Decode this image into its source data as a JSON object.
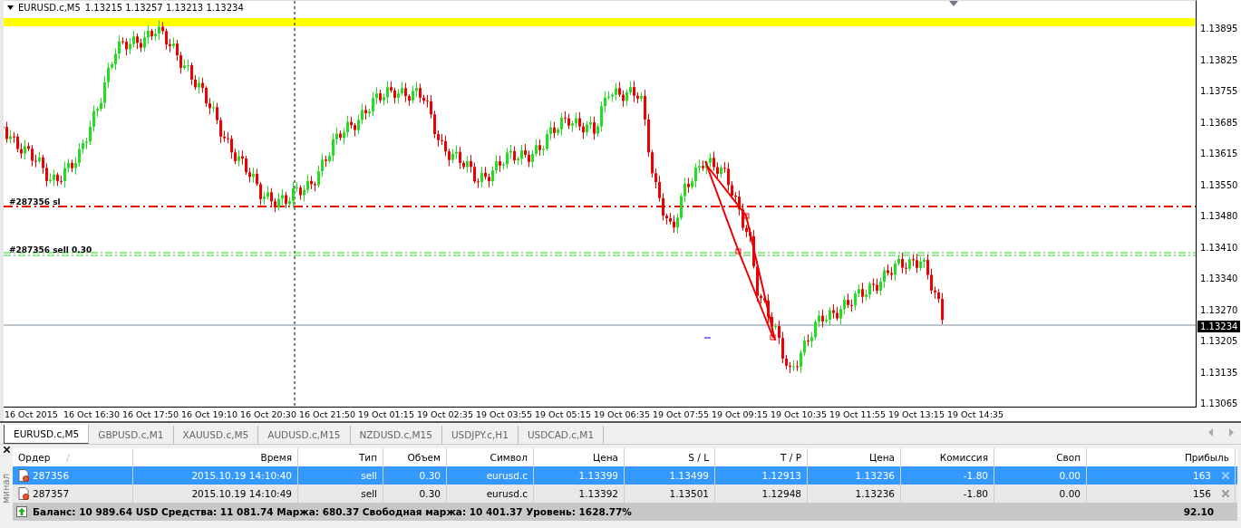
{
  "chart": {
    "symbol": "EURUSD.c,M5",
    "ohlc": "1.13215 1.13257 1.13213 1.13234",
    "price_labels": [
      "1.13895",
      "1.13825",
      "1.13755",
      "1.13685",
      "1.13615",
      "1.13550",
      "1.13480",
      "1.13410",
      "1.13340",
      "1.13270",
      "1.13205",
      "1.13135",
      "1.13065"
    ],
    "current_price": "1.13234",
    "time_labels": [
      "16 Oct 2015",
      "16 Oct 16:30",
      "16 Oct 17:50",
      "16 Oct 19:10",
      "16 Oct 20:30",
      "16 Oct 21:50",
      "19 Oct 01:15",
      "19 Oct 02:35",
      "19 Oct 03:55",
      "19 Oct 05:15",
      "19 Oct 06:35",
      "19 Oct 07:55",
      "19 Oct 09:15",
      "19 Oct 10:35",
      "19 Oct 11:55",
      "19 Oct 13:15",
      "19 Oct 14:35"
    ],
    "sl_label": "#287356 sl",
    "order_label": "#287356 sell 0.30"
  },
  "tabs": [
    {
      "label": "EURUSD.c,M5",
      "selected": true
    },
    {
      "label": "GBPUSD.c,M1",
      "selected": false
    },
    {
      "label": "XAUUSD.c,M5",
      "selected": false
    },
    {
      "label": "AUDUSD.c,M15",
      "selected": false
    },
    {
      "label": "NZDUSD.c,M15",
      "selected": false
    },
    {
      "label": "USDJPY.c,H1",
      "selected": false
    },
    {
      "label": "USDCAD.c,M1",
      "selected": false
    }
  ],
  "terminal": {
    "side_label": "минал",
    "sort_mark": "/",
    "columns": [
      "Ордер",
      "Время",
      "Тип",
      "Объем",
      "Символ",
      "Цена",
      "S / L",
      "T / P",
      "Цена",
      "Комиссия",
      "Своп",
      "Прибыль"
    ],
    "rows": [
      {
        "selected": true,
        "cells": [
          "287356",
          "2015.10.19 14:10:40",
          "sell",
          "0.30",
          "eurusd.c",
          "1.13399",
          "1.13499",
          "1.12913",
          "1.13236",
          "-1.80",
          "0.00",
          "163"
        ]
      },
      {
        "selected": false,
        "cells": [
          "287357",
          "2015.10.19 14:10:49",
          "sell",
          "0.30",
          "eurusd.c",
          "1.13392",
          "1.13501",
          "1.12948",
          "1.13236",
          "-1.80",
          "0.00",
          "156"
        ]
      }
    ],
    "summary": "Баланс: 10 989.64 USD  Средства: 11 081.74  Маржа: 680.37  Свободная маржа: 10 401.37  Уровень: 1628.77%",
    "total": "92.10"
  }
}
